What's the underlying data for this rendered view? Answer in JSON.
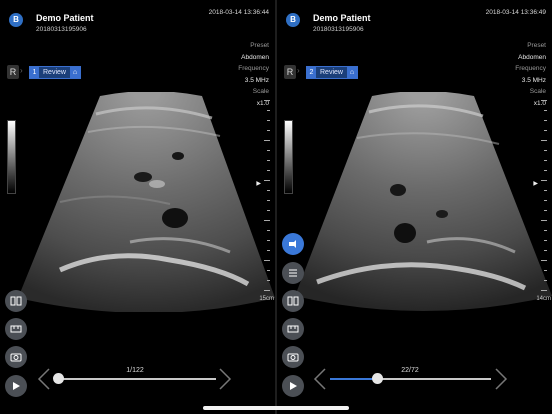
{
  "logo_glyph": "B",
  "panes": [
    {
      "patient_name": "Demo Patient",
      "patient_id": "20180313195906",
      "datetime": "2018-03-14 13:36:44",
      "params": [
        {
          "label": "Preset",
          "value": "Abdomen"
        },
        {
          "label": "Frequency",
          "value": "3.5 MHz"
        },
        {
          "label": "Scale",
          "value": "x1.0"
        }
      ],
      "r_label": "R",
      "review_index": "1",
      "review_label": "Review",
      "depth_label": "15cm",
      "frame_counter": "1/122",
      "frame_progress": 0.0
    },
    {
      "patient_name": "Demo Patient",
      "patient_id": "20180313195906",
      "datetime": "2018-03-14 13:36:49",
      "params": [
        {
          "label": "Preset",
          "value": "Abdomen"
        },
        {
          "label": "Frequency",
          "value": "3.5 MHz"
        },
        {
          "label": "Scale",
          "value": "x1.0"
        }
      ],
      "r_label": "R",
      "review_index": "2",
      "review_label": "Review",
      "depth_label": "14cm",
      "frame_counter": "22/72",
      "frame_progress": 0.29
    }
  ],
  "accent_color": "#3a78d8",
  "tool_icons": [
    "annotation-icon",
    "menu-icon",
    "compare-view-icon",
    "measure-icon",
    "camera-icon",
    "play-icon"
  ]
}
